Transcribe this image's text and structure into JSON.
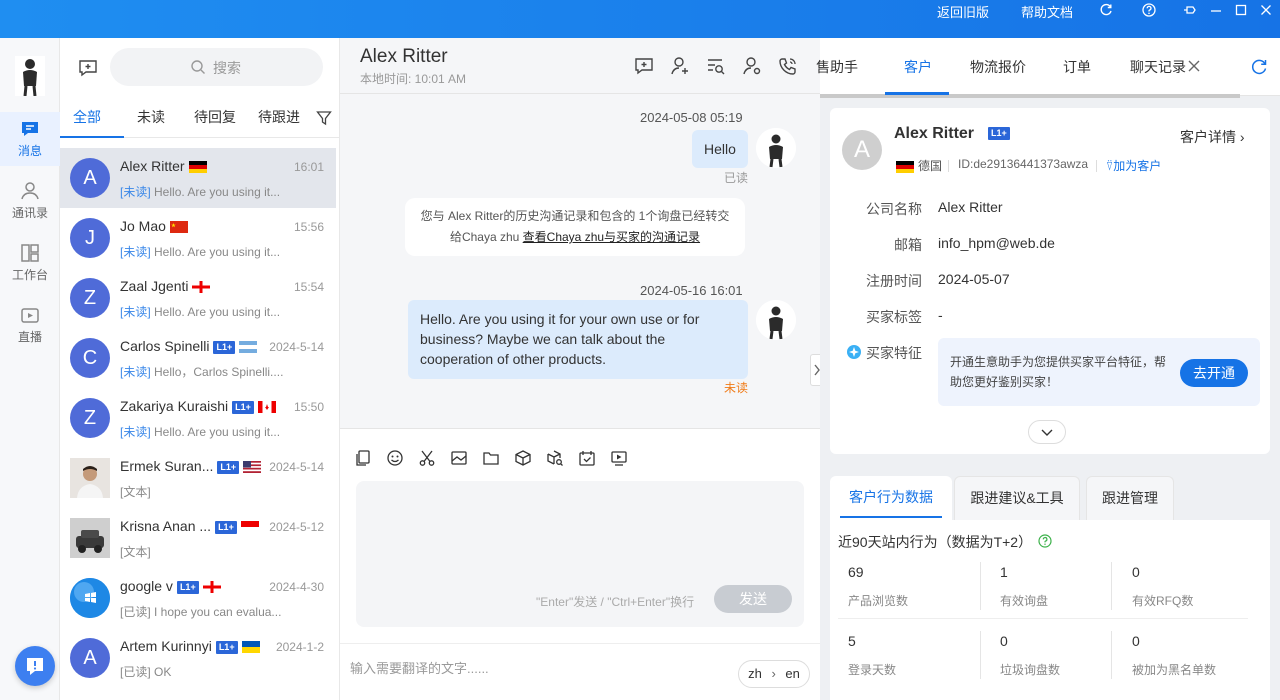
{
  "window": {
    "back_old": "返回旧版",
    "help_docs": "帮助文档"
  },
  "rail": {
    "items": [
      {
        "label": "消息"
      },
      {
        "label": "通讯录"
      },
      {
        "label": "工作台"
      },
      {
        "label": "直播"
      }
    ]
  },
  "conversations": {
    "search_placeholder": "搜索",
    "tabs": [
      "全部",
      "未读",
      "待回复",
      "待跟进"
    ],
    "items": [
      {
        "initial": "A",
        "name": "Alex Ritter",
        "time": "16:01",
        "tag": "[未读]",
        "msg": "Hello. Are you using it..."
      },
      {
        "initial": "J",
        "name": "Jo Mao",
        "time": "15:56",
        "tag": "[未读]",
        "msg": "Hello. Are you using it..."
      },
      {
        "initial": "Z",
        "name": "Zaal Jgenti",
        "time": "15:54",
        "tag": "[未读]",
        "msg": "Hello. Are you using it..."
      },
      {
        "initial": "C",
        "name": "Carlos Spinelli",
        "badge": "L1+",
        "time": "2024-5-14",
        "tag": "[未读]",
        "msg": "Hello，Carlos Spinelli...."
      },
      {
        "initial": "Z",
        "name": "Zakariya Kuraishi",
        "badge": "L1+",
        "time": "15:50",
        "tag": "[未读]",
        "msg": "Hello. Are you using it..."
      },
      {
        "initial": "",
        "name": "Ermek Suran...",
        "badge": "L1+",
        "time": "2024-5-14",
        "tag": "",
        "msg": "[文本]"
      },
      {
        "initial": "",
        "name": "Krisna Anan ...",
        "badge": "L1+",
        "time": "2024-5-12",
        "tag": "",
        "msg": "[文本]"
      },
      {
        "initial": "",
        "name": "google v",
        "badge": "L1+",
        "time": "2024-4-30",
        "tag": "",
        "msg": "[已读] I hope you can evalua..."
      },
      {
        "initial": "A",
        "name": "Artem Kurinnyi",
        "badge": "L1+",
        "time": "2024-1-2",
        "tag": "",
        "msg": "[已读] OK"
      }
    ]
  },
  "chat": {
    "name": "Alex Ritter",
    "local_time": "本地时间: 10:01 AM",
    "messages": [
      {
        "time": "2024-05-08 05:19",
        "text": "Hello",
        "status": "已读"
      },
      {
        "time": "2024-05-16 16:01",
        "text": "Hello. Are you using it for your own use or for business? Maybe we can talk about the cooperation of other products.",
        "status": "未读"
      }
    ],
    "system_note_1": "您与 Alex Ritter的历史沟通记录和包含的 1个询盘已经转交",
    "system_note_2": "给Chaya zhu",
    "system_note_link": "查看Chaya zhu与买家的沟通记录",
    "input_hint": "\"Enter\"发送 / \"Ctrl+Enter\"换行",
    "send": "发送",
    "translate_placeholder": "输入需要翻译的文字......",
    "lang_from": "zh",
    "lang_to": "en"
  },
  "right": {
    "tabs": [
      "售助手",
      "客户",
      "物流报价",
      "订单",
      "聊天记录"
    ],
    "customer": {
      "initial": "A",
      "name": "Alex Ritter",
      "badge": "L1+",
      "detail_link": "客户详情",
      "country": "德国",
      "id": "ID:de29136441373awza",
      "add": "加为客户",
      "fields": [
        {
          "label": "公司名称",
          "value": "Alex Ritter"
        },
        {
          "label": "邮箱",
          "value": "info_hpm@web.de"
        },
        {
          "label": "注册时间",
          "value": "2024-05-07"
        },
        {
          "label": "买家标签",
          "value": "-"
        }
      ],
      "feature_label": "买家特征",
      "feature_text": "开通生意助手为您提供买家平台特征，帮助您更好鉴别买家！",
      "feature_btn": "去开通"
    },
    "bottom_tabs": [
      "客户行为数据",
      "跟进建议&工具",
      "跟进管理"
    ],
    "stats_title": "近90天站内行为（数据为T+2）",
    "stats": [
      {
        "value": "69",
        "label": "产品浏览数"
      },
      {
        "value": "1",
        "label": "有效询盘"
      },
      {
        "value": "0",
        "label": "有效RFQ数"
      },
      {
        "value": "5",
        "label": "登录天数"
      },
      {
        "value": "0",
        "label": "垃圾询盘数"
      },
      {
        "value": "0",
        "label": "被加为黑名单数"
      }
    ]
  }
}
